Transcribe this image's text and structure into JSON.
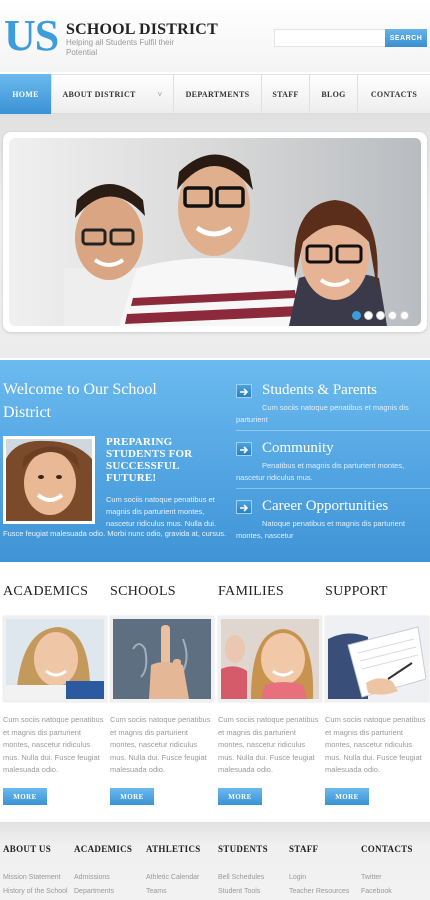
{
  "header": {
    "logo_mark": "US",
    "title": "SCHOOL DISTRICT",
    "tagline": "Helping all Students Fulfil their Potential",
    "search_placeholder": "",
    "search_label": "SEARCH"
  },
  "nav": {
    "items": [
      {
        "label": "HOME"
      },
      {
        "label": "ABOUT DISTRICT",
        "chevron": "˅"
      },
      {
        "label": "DEPARTMENTS"
      },
      {
        "label": "STAFF"
      },
      {
        "label": "BLOG"
      },
      {
        "label": "CONTACTS"
      }
    ],
    "active": "HOME"
  },
  "slider": {
    "dots": 5,
    "active_dot": 1
  },
  "welcome": {
    "title": "Welcome to Our School District",
    "heading": "PREPARING STUDENTS FOR SUCCESSFUL FUTURE!",
    "text": "Cum sociis natoque penatibus et magnis dis parturient montes, nascetur ridiculus mus. Nulla dui.",
    "text_cont": "Fusce feugiat malesuada odio. Morbi nunc odio, gravida at, cursus."
  },
  "features": [
    {
      "title": "Students & Parents",
      "text": "Cum sociis natoque penatibus et magnis dis parturient"
    },
    {
      "title": "Community",
      "text": "Penatibus et magnis dis parturient montes, nascetur ridiculus mus."
    },
    {
      "title": "Career Opportunities",
      "text": "Natoque penatibus et magnis dis parturient montes, nascetur"
    }
  ],
  "columns": [
    {
      "title": "ACADEMICS",
      "text": "Cum sociis natoque penatibus et magnis dis parturient montes, nascetur ridiculus mus. Nulla dui. Fusce feugiat malesuada odio.",
      "more": "MORE"
    },
    {
      "title": "SCHOOLS",
      "text": "Cum sociis natoque penatibus et magnis dis parturient montes, nascetur ridiculus mus. Nulla dui. Fusce feugiat malesuada odio.",
      "more": "MORE"
    },
    {
      "title": "FAMILIES",
      "text": "Cum sociis natoque penatibus et magnis dis parturient montes, nascetur ridiculus mus. Nulla dui. Fusce feugiat malesuada odio.",
      "more": "MORE"
    },
    {
      "title": "SUPPORT",
      "text": "Cum sociis natoque penatibus et magnis dis parturient montes, nascetur ridiculus mus. Nulla dui. Fusce feugiat malesuada odio.",
      "more": "MORE"
    }
  ],
  "footer": {
    "columns": [
      {
        "title": "ABOUT US",
        "links": [
          "Mission Statement",
          "History of the School"
        ]
      },
      {
        "title": "ACADEMICS",
        "links": [
          "Admissions",
          "Departments"
        ]
      },
      {
        "title": "ATHLETICS",
        "links": [
          "Athletic Calendar",
          "Teams"
        ]
      },
      {
        "title": "STUDENTS",
        "links": [
          "Bell Schedules",
          "Student Tools"
        ]
      },
      {
        "title": "STAFF",
        "links": [
          "Login",
          "Teacher Resources"
        ]
      },
      {
        "title": "CONTACTS",
        "links": [
          "Twitter",
          "Facebook"
        ]
      }
    ]
  },
  "colors": {
    "accent": "#3d9cdc",
    "accent_dark": "#3a92d4",
    "band_top": "#6bbaf0",
    "band_bottom": "#3f94d6"
  }
}
